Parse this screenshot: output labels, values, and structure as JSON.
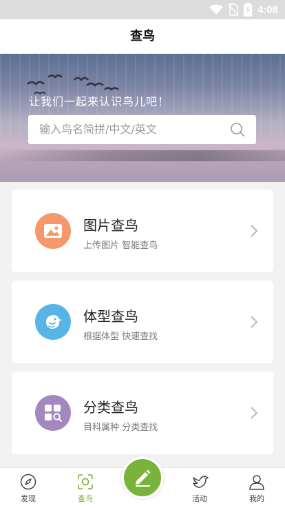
{
  "status_bar": {
    "time": "4:08"
  },
  "header": {
    "title": "查鸟"
  },
  "banner": {
    "slogan": "让我们一起来认识鸟儿吧！",
    "search_placeholder": "输入鸟名简拼/中文/英文"
  },
  "cards": [
    {
      "title": "图片查鸟",
      "subtitle": "上传图片 智能查鸟",
      "icon": "image-icon",
      "color": "#f5986b"
    },
    {
      "title": "体型查鸟",
      "subtitle": "根据体型 快速查找",
      "icon": "bird-icon",
      "color": "#57b5e5"
    },
    {
      "title": "分类查鸟",
      "subtitle": "目科属种 分类查找",
      "icon": "category-icon",
      "color": "#a487be"
    }
  ],
  "bottom_nav": [
    {
      "label": "发现",
      "icon": "compass-icon",
      "active": false
    },
    {
      "label": "查鸟",
      "icon": "scan-icon",
      "active": true
    },
    {
      "label": "活动",
      "icon": "dove-icon",
      "active": false
    },
    {
      "label": "我的",
      "icon": "user-icon",
      "active": false
    }
  ],
  "fab": {
    "icon": "pencil-icon",
    "color": "#7ab33c"
  },
  "colors": {
    "accent": "#76ad3c"
  }
}
